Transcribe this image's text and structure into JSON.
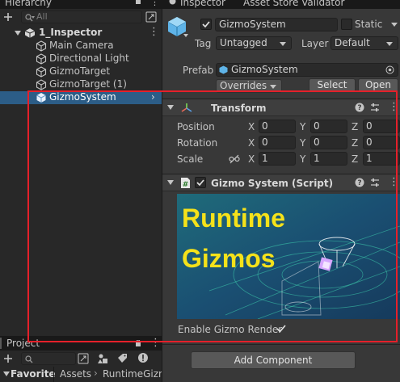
{
  "hierarchy": {
    "tab_label": "Hierarchy",
    "search_placeholder": "All",
    "scene_name": "1_Inspector",
    "items": [
      {
        "label": "Main Camera"
      },
      {
        "label": "Directional Light"
      },
      {
        "label": "GizmoTarget"
      },
      {
        "label": "GizmoTarget (1)"
      },
      {
        "label": "GizmoSystem"
      }
    ]
  },
  "project": {
    "tab_label": "Project",
    "favorites_label": "Favorite",
    "breadcrumb": [
      "Assets",
      "RuntimeGizn"
    ]
  },
  "inspector": {
    "tab_label": "Inspector",
    "other_tab_label": "Asset Store Validator",
    "object_name": "GizmoSystem",
    "static_label": "Static",
    "tag_label": "Tag",
    "tag_value": "Untagged",
    "layer_label": "Layer",
    "layer_value": "Default",
    "prefab_label": "Prefab",
    "prefab_value": "GizmoSystem",
    "overrides_label": "Overrides",
    "select_label": "Select",
    "open_label": "Open"
  },
  "transform": {
    "title": "Transform",
    "rows": [
      {
        "label": "Position",
        "x": "0",
        "y": "0",
        "z": "0"
      },
      {
        "label": "Rotation",
        "x": "0",
        "y": "0",
        "z": "0"
      },
      {
        "label": "Scale",
        "x": "1",
        "y": "1",
        "z": "1"
      }
    ],
    "axis_x": "X",
    "axis_y": "Y",
    "axis_z": "Z"
  },
  "script_component": {
    "title": "Gizmo System (Script)",
    "banner_line1": "Runtime",
    "banner_line2": "Gizmos",
    "enable_label": "Enable Gizmo Render",
    "enable_checked": true
  },
  "add_component_label": "Add Component",
  "colors": {
    "selection": "#2c5d87",
    "annotation": "#e5202a",
    "banner_text": "#f5e21a"
  }
}
